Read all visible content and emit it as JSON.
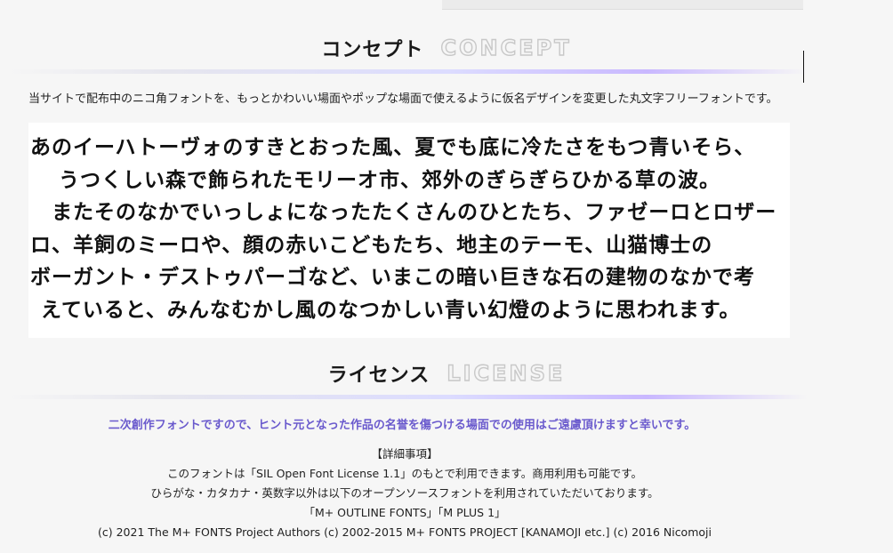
{
  "concept": {
    "title_jp": "コンセプト",
    "title_en": "CONCEPT",
    "intro": "当サイトで配布中のニコ角フォントを、もっとかわいい場面やポップな場面で使えるように仮名デザインを変更した丸文字フリーフォントです。",
    "sample_lines": [
      "あのイーハトーヴォのすきとおった風、夏でも底に冷たさをもつ青いそら、",
      "うつくしい森で飾られたモリーオ市、郊外のぎらぎらひかる草の波。",
      "　またそのなかでいっしょになったたくさんのひとたち、ファゼーロとロザー",
      "ロ、羊飼のミーロや、顔の赤いこどもたち、地主のテーモ、山猫博士の",
      "ボーガント・デストゥパーゴなど、いまこの暗い巨きな石の建物のなかで考",
      "えていると、みんなむかし風のなつかしい青い幻燈のように思われます。"
    ]
  },
  "license": {
    "title_jp": "ライセンス",
    "title_en": "LICENSE",
    "note": "二次創作フォントですので、ヒント元となった作品の名誉を傷つける場面での使用はご遠慮頂けますと幸いです。",
    "details_heading": "【詳細事項】",
    "details": [
      "このフォントは「SIL Open Font License 1.1」のもとで利用できます。商用利用も可能です。",
      "ひらがな・カタカナ・英数字以外は以下のオープンソースフォントを利用されていただいております。",
      "「M+ OUTLINE FONTS」「M PLUS 1」",
      "(c) 2021 The M+ FONTS Project Authors (c) 2002-2015 M+ FONTS PROJECT [KANAMOJI etc.] (c) 2016 Nicomoji"
    ]
  },
  "colors": {
    "background": "#f6f6f6",
    "note_text": "#6a5acd",
    "divider_accent": "#c9b8ff"
  }
}
